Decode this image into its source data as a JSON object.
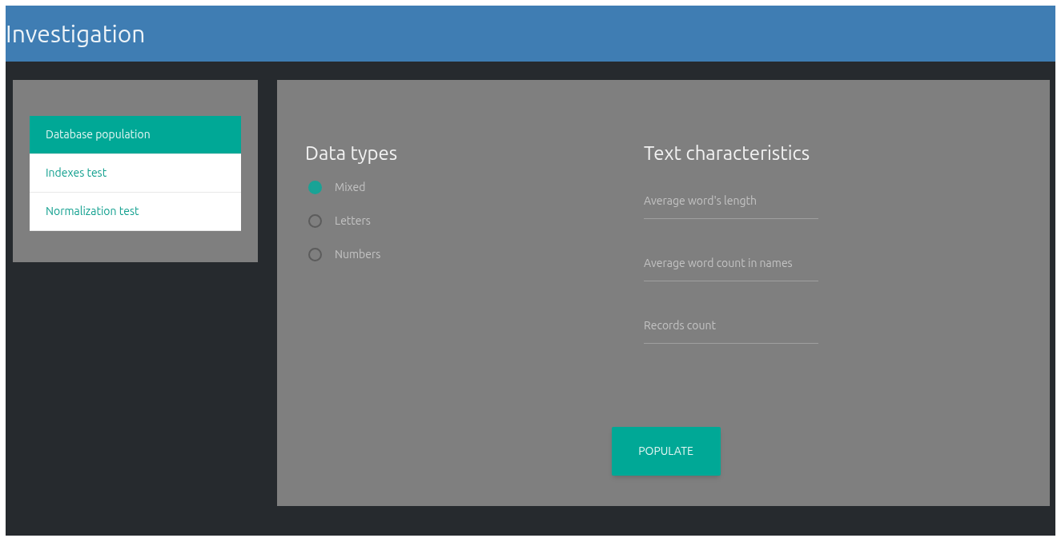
{
  "header": {
    "title": "Investigation"
  },
  "menu": [
    {
      "label": "Database population",
      "selected": true
    },
    {
      "label": "Indexes test",
      "selected": false
    },
    {
      "label": "Normalization test",
      "selected": false
    }
  ],
  "data_types": {
    "title": "Data types",
    "options": [
      {
        "label": "Mixed",
        "selected": true
      },
      {
        "label": "Letters",
        "selected": false
      },
      {
        "label": "Numbers",
        "selected": false
      }
    ]
  },
  "text_characteristics": {
    "title": "Text characteristics",
    "fields": [
      {
        "placeholder": "Average word's length"
      },
      {
        "placeholder": "Average word count in names"
      },
      {
        "placeholder": "Records count"
      }
    ]
  },
  "populate_button": "POPULATE"
}
